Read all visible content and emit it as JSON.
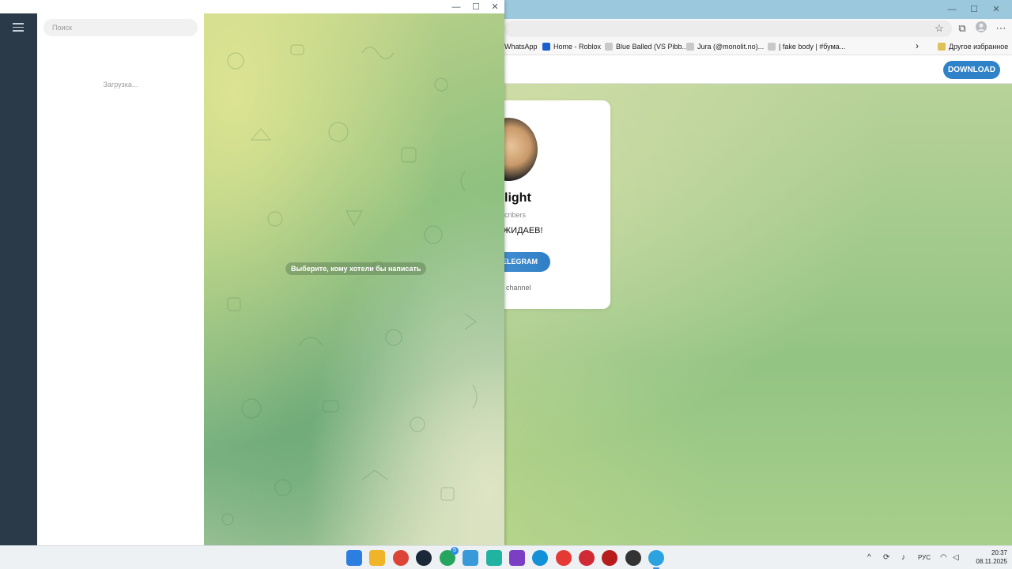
{
  "browser": {
    "controls": {
      "minimize": "—",
      "maximize": "☐",
      "close": "✕"
    },
    "bookmarks": [
      {
        "label": "WhatsApp"
      },
      {
        "label": "Home - Roblox"
      },
      {
        "label": "Blue Balled (VS Pibb..."
      },
      {
        "label": "Jura (@monolit.no)..."
      },
      {
        "label": "| fake body | #бума..."
      }
    ],
    "bookmarks_more": "›",
    "other_bookmarks": "Другое избранное",
    "download_button": "DOWNLOAD",
    "channel_card": {
      "title": "light",
      "subscribers": "cribers",
      "description": "ЖИДАЕВ!",
      "button": "ELEGRAM",
      "link": "channel"
    }
  },
  "telegram": {
    "controls": {
      "minimize": "—",
      "maximize": "☐",
      "close": "✕"
    },
    "search": {
      "placeholder": "Поиск",
      "value": ""
    },
    "loading": "Загрузка...",
    "empty_hint": "Выберите, кому хотели бы написать"
  },
  "taskbar": {
    "apps": [
      {
        "name": "start",
        "color": "#2a7fe0"
      },
      {
        "name": "file-explorer",
        "color": "#f0b429"
      },
      {
        "name": "chrome",
        "color": "#db4437"
      },
      {
        "name": "steam",
        "color": "#1b2838"
      },
      {
        "name": "whatsapp",
        "color": "#25a55e",
        "badge": "5"
      },
      {
        "name": "notepad",
        "color": "#3a9ad9"
      },
      {
        "name": "vpn",
        "color": "#1fb3a0"
      },
      {
        "name": "app-purple",
        "color": "#7b3fc4"
      },
      {
        "name": "edge",
        "color": "#1490d8"
      },
      {
        "name": "yandex",
        "color": "#e53935"
      },
      {
        "name": "opera",
        "color": "#d12a35"
      },
      {
        "name": "app-red",
        "color": "#b71c1c"
      },
      {
        "name": "app-dark",
        "color": "#333333"
      },
      {
        "name": "telegram",
        "color": "#2aa3e0"
      }
    ],
    "tray": {
      "chevron": "^",
      "lang": "РУС",
      "time": "20:37",
      "date": "08.11.2025"
    }
  }
}
